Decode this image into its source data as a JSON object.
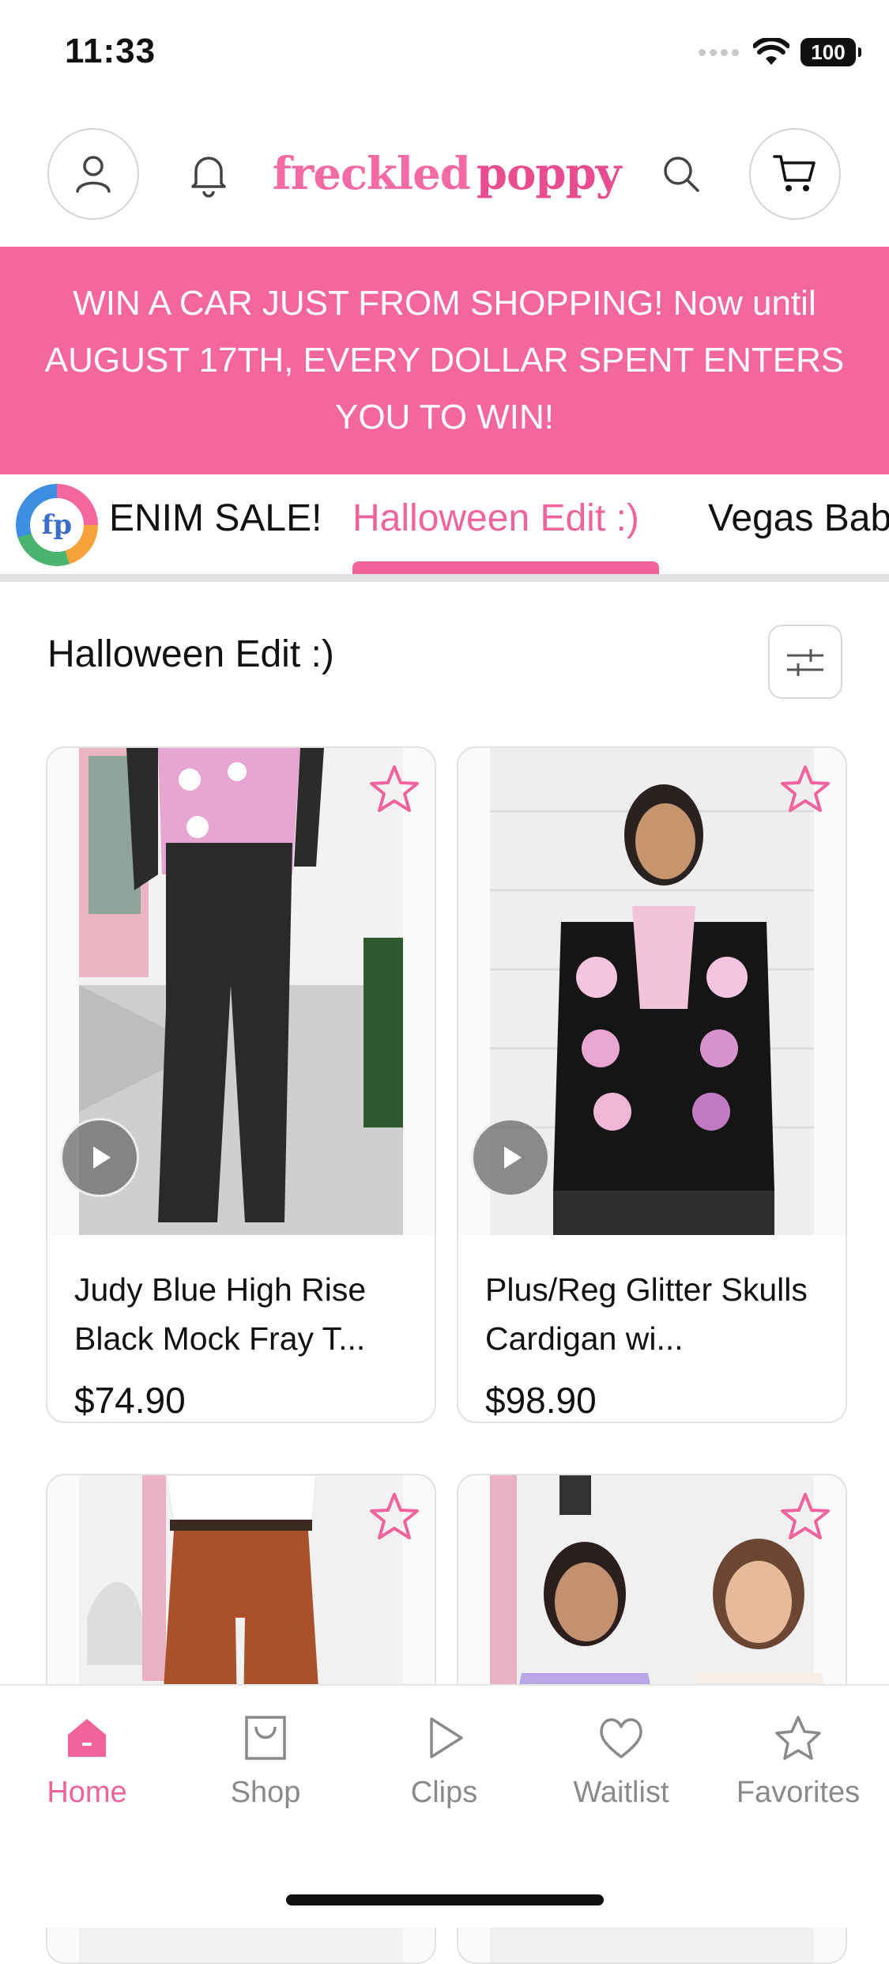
{
  "status_bar": {
    "time": "11:33",
    "battery": "100"
  },
  "header": {
    "logo_part1": "freckled",
    "logo_part2": "poppy"
  },
  "promo": {
    "text": "WIN A CAR JUST FROM SHOPPING! Now until AUGUST 17TH, EVERY DOLLAR SPENT ENTERS YOU TO WIN!"
  },
  "categories": {
    "avatar_text": "fp",
    "tabs": [
      {
        "label": "ENIM SALE!"
      },
      {
        "label": "Halloween Edit :)"
      },
      {
        "label": "Vegas Bab"
      }
    ],
    "active_index": 1
  },
  "section": {
    "title": "Halloween Edit :)"
  },
  "products": [
    {
      "name": "Judy Blue High Rise Black Mock Fray T...",
      "price": "$74.90"
    },
    {
      "name": "Plus/Reg Glitter Skulls Cardigan wi...",
      "price": "$98.90"
    },
    {
      "name": "",
      "price": ""
    },
    {
      "name": "",
      "price": ""
    }
  ],
  "tabbar": {
    "items": [
      {
        "label": "Home",
        "icon": "home-icon"
      },
      {
        "label": "Shop",
        "icon": "shopping-bag-icon"
      },
      {
        "label": "Clips",
        "icon": "play-icon"
      },
      {
        "label": "Waitlist",
        "icon": "heart-icon"
      },
      {
        "label": "Favorites",
        "icon": "star-icon"
      }
    ]
  },
  "colors": {
    "brand_pink": "#f4679c",
    "accent_pink": "#f0649b"
  }
}
